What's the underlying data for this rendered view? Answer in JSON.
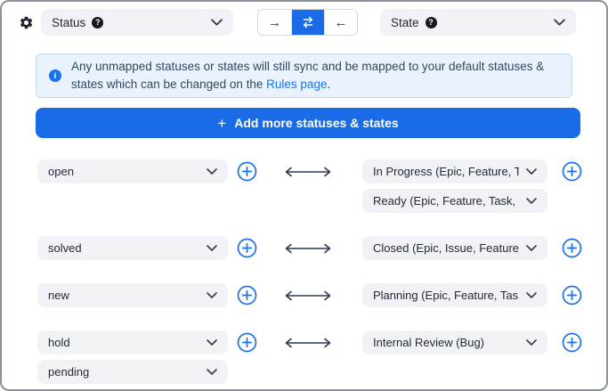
{
  "top_bar": {
    "status_field": {
      "label": "Status",
      "help_glyph": "?"
    },
    "state_field": {
      "label": "State",
      "help_glyph": "?"
    },
    "direction_toggle": {
      "selected": "two-way",
      "options": [
        {
          "name": "one-way-right",
          "glyph": "→",
          "active": false
        },
        {
          "name": "two-way-sync",
          "glyph": "⇄",
          "active": true
        },
        {
          "name": "one-way-left",
          "glyph": "←",
          "active": false
        }
      ]
    }
  },
  "banner": {
    "icon": "info-icon",
    "text": "Any unmapped statuses or states will still sync and be mapped to your default statuses & states which can be changed on the ",
    "link_text": "Rules page",
    "suffix": "."
  },
  "add_button": {
    "plus_glyph": "+",
    "label": "Add more statuses & states"
  },
  "mappings": [
    {
      "left": [
        "open"
      ],
      "right": [
        "In Progress (Epic, Feature, Task, ...",
        "Ready (Epic, Feature, Task, Bug, T..."
      ]
    },
    {
      "left": [
        "solved"
      ],
      "right": [
        "Closed (Epic, Issue, Feature, Task..."
      ]
    },
    {
      "left": [
        "new"
      ],
      "right": [
        "Planning (Epic, Feature, Task, Bu..."
      ]
    },
    {
      "left": [
        "hold",
        "pending"
      ],
      "right": [
        "Internal Review (Bug)"
      ]
    }
  ],
  "colors": {
    "accent": "#1a6ce6",
    "link": "#1a73e8",
    "banner_bg": "#eaf3fd",
    "banner_border": "#c2d9f5",
    "pill_bg": "#f0f2f5",
    "arrow": "#2a3a55",
    "container_border": "#8b929c"
  }
}
